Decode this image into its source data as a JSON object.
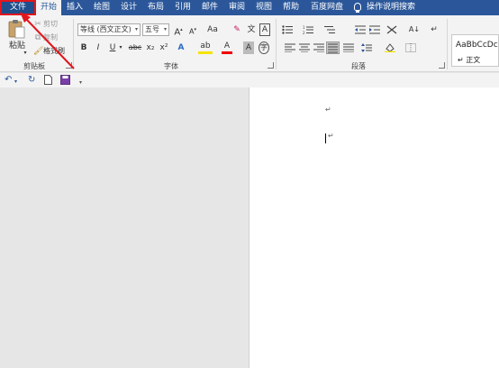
{
  "tabs": [
    "文件",
    "开始",
    "插入",
    "绘图",
    "设计",
    "布局",
    "引用",
    "邮件",
    "审阅",
    "视图",
    "帮助",
    "百度网盘",
    "操作说明搜索"
  ],
  "clipboard": {
    "paste": "粘贴",
    "cut": "剪切",
    "copy": "复制",
    "format_painter": "格式刷",
    "group": "剪贴板"
  },
  "font": {
    "font_name": "等线 (西文正文)",
    "font_size": "五号",
    "grow": "A",
    "shrink": "A",
    "change_case": "Aa",
    "bold": "B",
    "italic": "I",
    "underline": "U",
    "strike": "abc",
    "subscript": "x₂",
    "superscript": "x²",
    "text_effects": "A",
    "highlight": "ab",
    "font_color": "A",
    "char_shading": "A",
    "phonetic": "文",
    "char_border": "A",
    "group": "字体"
  },
  "paragraph": {
    "group": "段落",
    "sort": "A↓"
  },
  "styles": {
    "sample": "AaBbCcDc",
    "name": "↵ 正文"
  },
  "qat": {
    "undo": "↶",
    "redo": "↻",
    "new": "🗋",
    "save": "💾",
    "customize": "▾"
  },
  "document": {
    "paragraph_mark": "↵"
  },
  "colors": {
    "tab_bar": "#2b579a",
    "highlight_annotation": "#e1161d"
  }
}
